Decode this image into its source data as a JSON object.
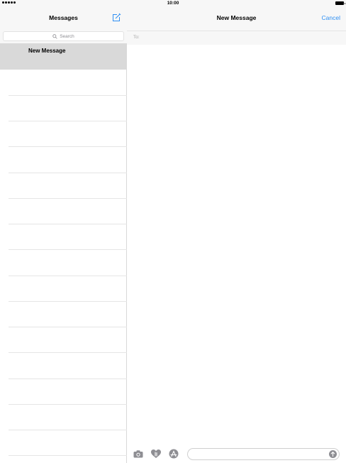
{
  "status_bar": {
    "time": "10:00"
  },
  "sidebar": {
    "title": "Messages",
    "search_placeholder": "Search",
    "selected_thread": "New Message"
  },
  "main": {
    "title": "New Message",
    "cancel_label": "Cancel",
    "to_label": "To:"
  },
  "icons": {
    "compose": "compose-icon",
    "search": "search-icon",
    "camera": "camera-icon",
    "digital_touch": "digital-touch-icon",
    "app_store": "app-store-icon",
    "send": "send-arrow-icon"
  },
  "colors": {
    "accent": "#2f8ff3",
    "selected_row": "#d9d9d9",
    "header_bg": "#f7f7f7"
  }
}
